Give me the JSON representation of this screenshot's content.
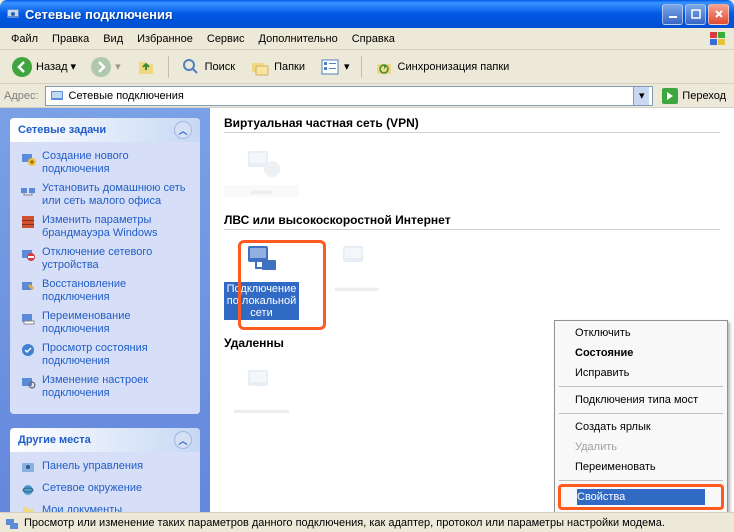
{
  "window": {
    "title": "Сетевые подключения"
  },
  "menu": [
    "Файл",
    "Правка",
    "Вид",
    "Избранное",
    "Сервис",
    "Дополнительно",
    "Справка"
  ],
  "toolbar": {
    "back": "Назад",
    "search": "Поиск",
    "folders": "Папки",
    "sync": "Синхронизация папки"
  },
  "address": {
    "label": "Адрес:",
    "value": "Сетевые подключения",
    "go": "Переход"
  },
  "sidebar": {
    "tasks": {
      "title": "Сетевые задачи",
      "items": [
        "Создание нового подключения",
        "Установить домашнюю сеть или сеть малого офиса",
        "Изменить параметры брандмауэра Windows",
        "Отключение сетевого устройства",
        "Восстановление подключения",
        "Переименование подключения",
        "Просмотр состояния подключения",
        "Изменение настроек подключения"
      ]
    },
    "places": {
      "title": "Другие места",
      "items": [
        "Панель управления",
        "Сетевое окружение",
        "Мои документы"
      ]
    }
  },
  "content": {
    "sec1": "Виртуальная частная сеть (VPN)",
    "sec2": "ЛВС или высокоскоростной Интернет",
    "sec3": "Удаленны",
    "conn_selected": "Подключение по локальной сети"
  },
  "context_menu": {
    "items": [
      {
        "label": "Отключить",
        "disabled": false
      },
      {
        "label": "Состояние",
        "disabled": false,
        "bold": true
      },
      {
        "label": "Исправить",
        "disabled": false
      }
    ],
    "items2": [
      {
        "label": "Подключения типа мост",
        "disabled": false
      }
    ],
    "items3": [
      {
        "label": "Создать ярлык",
        "disabled": false
      },
      {
        "label": "Удалить",
        "disabled": true
      },
      {
        "label": "Переименовать",
        "disabled": false
      }
    ],
    "properties": "Свойства"
  },
  "statusbar": {
    "text": "Просмотр или изменение таких параметров данного подключения, как адаптер, протокол или параметры настройки модема."
  }
}
